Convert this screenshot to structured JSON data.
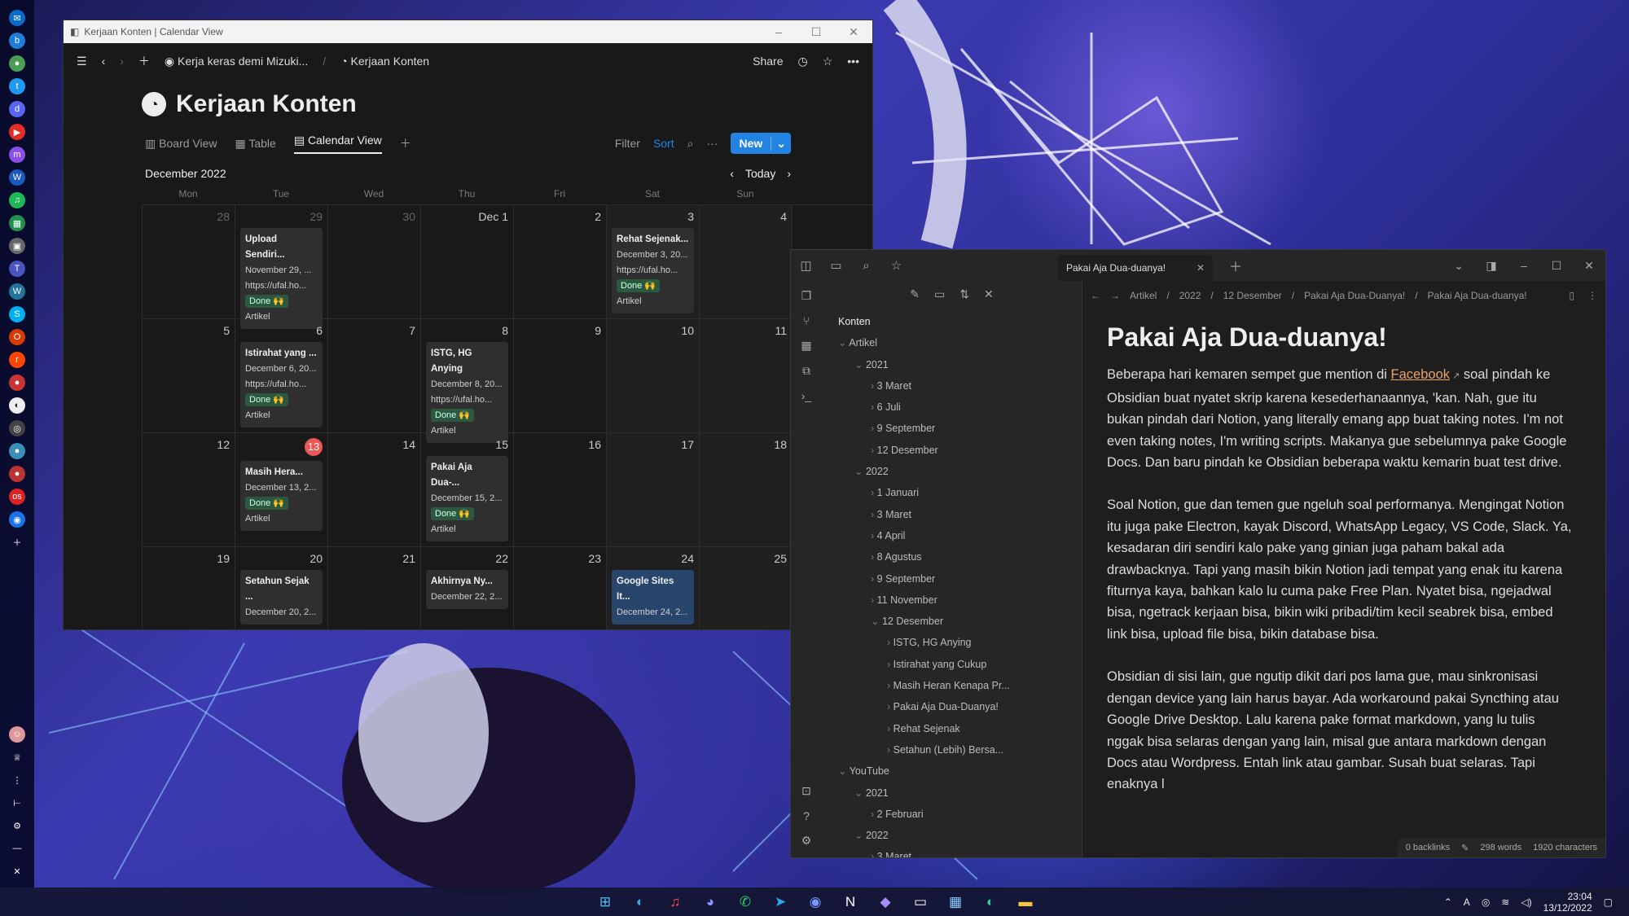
{
  "colors": {
    "notion_bg": "#191919",
    "accent_blue": "#2383e2",
    "done_green": "#2b593f",
    "today_red": "#eb5757",
    "link": "#e8a36a",
    "obsidian_bg": "#1e1e1e"
  },
  "dock": {
    "icons": [
      "outlook-icon",
      "bing-icon",
      "chrome-icon",
      "twitter-icon",
      "discord-icon",
      "youtube-icon",
      "messenger-icon",
      "word-icon",
      "spotify-icon",
      "sheets-icon",
      "app-icon",
      "teams-icon",
      "wordpress-icon",
      "skype-icon",
      "office-icon",
      "reddit-icon",
      "app-icon",
      "app-icon",
      "globe-icon",
      "app-icon",
      "app-icon",
      "app-icon",
      "chat-icon",
      "add-icon"
    ]
  },
  "notion": {
    "window_title": "Kerjaan Konten | Calendar View",
    "breadcrumb_parent": "Kerja keras demi Mizuki...",
    "breadcrumb_current": "Kerjaan Konten",
    "share": "Share",
    "page_title": "Kerjaan Konten",
    "tabs": [
      "Board View",
      "Table",
      "Calendar View"
    ],
    "filter": "Filter",
    "sort": "Sort",
    "new": "New",
    "month": "December 2022",
    "today": "Today",
    "days": [
      "Mon",
      "Tue",
      "Wed",
      "Thu",
      "Fri",
      "Sat",
      "Sun"
    ],
    "cells": [
      {
        "d": "28",
        "m": true
      },
      {
        "d": "29",
        "m": true,
        "card": {
          "t": "Upload Sendiri...",
          "date": "November 29, ...",
          "url": "https://ufal.ho...",
          "badge": "Done 🙌",
          "tag": "Artikel"
        }
      },
      {
        "d": "30",
        "m": true
      },
      {
        "d": "Dec 1"
      },
      {
        "d": "2"
      },
      {
        "d": "3",
        "we": true,
        "card": {
          "t": "Rehat Sejenak...",
          "date": "December 3, 20...",
          "url": "https://ufal.ho...",
          "badge": "Done 🙌",
          "tag": "Artikel"
        }
      },
      {
        "d": "4",
        "we": true
      },
      {
        "d": "5"
      },
      {
        "d": "6",
        "card": {
          "t": "Istirahat yang ...",
          "date": "December 6, 20...",
          "url": "https://ufal.ho...",
          "badge": "Done 🙌",
          "tag": "Artikel"
        }
      },
      {
        "d": "7"
      },
      {
        "d": "8",
        "card": {
          "t": "ISTG, HG Anying",
          "date": "December 8, 20...",
          "url": "https://ufal.ho...",
          "badge": "Done 🙌",
          "tag": "Artikel"
        }
      },
      {
        "d": "9"
      },
      {
        "d": "10",
        "we": true
      },
      {
        "d": "11",
        "we": true
      },
      {
        "d": "12"
      },
      {
        "d": "13",
        "today": true,
        "card": {
          "t": "Masih Hera...",
          "date": "December 13, 2...",
          "url": "",
          "badge": "Done 🙌",
          "tag": "Artikel"
        }
      },
      {
        "d": "14"
      },
      {
        "d": "15",
        "card": {
          "t": "Pakai Aja Dua-...",
          "date": "December 15, 2...",
          "url": "",
          "badge": "Done 🙌",
          "tag": "Artikel"
        }
      },
      {
        "d": "16"
      },
      {
        "d": "17",
        "we": true
      },
      {
        "d": "18",
        "we": true
      },
      {
        "d": "19"
      },
      {
        "d": "20",
        "card": {
          "t": "Setahun Sejak ...",
          "date": "December 20, 2...",
          "url": "",
          "badge": "",
          "tag": ""
        }
      },
      {
        "d": "21"
      },
      {
        "d": "22",
        "card": {
          "t": "Akhirnya Ny...",
          "date": "December 22, 2...",
          "url": "",
          "badge": "",
          "tag": ""
        }
      },
      {
        "d": "23"
      },
      {
        "d": "24",
        "we": true,
        "card": {
          "t": "Google Sites It...",
          "date": "December 24, 2...",
          "url": "",
          "badge": "",
          "tag": "",
          "blue": true
        }
      },
      {
        "d": "25",
        "we": true
      }
    ]
  },
  "obsidian": {
    "tab": "Pakai Aja Dua-duanya!",
    "breadcrumb": [
      "Artikel",
      "2022",
      "12 Desember",
      "Pakai Aja Dua-Duanya!",
      "Pakai Aja Dua-duanya!"
    ],
    "tree": [
      {
        "t": "Konten",
        "l": 0,
        "c": ""
      },
      {
        "t": "Artikel",
        "l": 0,
        "c": "⌄"
      },
      {
        "t": "2021",
        "l": 1,
        "c": "⌄"
      },
      {
        "t": "3 Maret",
        "l": 2,
        "c": "›"
      },
      {
        "t": "6 Juli",
        "l": 2,
        "c": "›"
      },
      {
        "t": "9 September",
        "l": 2,
        "c": "›"
      },
      {
        "t": "12 Desember",
        "l": 2,
        "c": "›"
      },
      {
        "t": "2022",
        "l": 1,
        "c": "⌄"
      },
      {
        "t": "1 Januari",
        "l": 2,
        "c": "›"
      },
      {
        "t": "3 Maret",
        "l": 2,
        "c": "›"
      },
      {
        "t": "4 April",
        "l": 2,
        "c": "›"
      },
      {
        "t": "8 Agustus",
        "l": 2,
        "c": "›"
      },
      {
        "t": "9 September",
        "l": 2,
        "c": "›"
      },
      {
        "t": "11 November",
        "l": 2,
        "c": "›"
      },
      {
        "t": "12 Desember",
        "l": 2,
        "c": "⌄"
      },
      {
        "t": "ISTG, HG Anying",
        "l": 3,
        "c": "›"
      },
      {
        "t": "Istirahat yang Cukup",
        "l": 3,
        "c": "›"
      },
      {
        "t": "Masih Heran Kenapa Pr...",
        "l": 3,
        "c": "›"
      },
      {
        "t": "Pakai Aja Dua-Duanya!",
        "l": 3,
        "c": "›"
      },
      {
        "t": "Rehat Sejenak",
        "l": 3,
        "c": "›"
      },
      {
        "t": "Setahun (Lebih) Bersa...",
        "l": 3,
        "c": "›"
      },
      {
        "t": "YouTube",
        "l": 0,
        "c": "⌄"
      },
      {
        "t": "2021",
        "l": 1,
        "c": "⌄"
      },
      {
        "t": "2 Februari",
        "l": 2,
        "c": "›"
      },
      {
        "t": "2022",
        "l": 1,
        "c": "⌄"
      },
      {
        "t": "3 Maret",
        "l": 2,
        "c": "›"
      }
    ],
    "doc_title": "Pakai Aja Dua-duanya!",
    "p1_pre": "Beberapa hari kemaren sempet gue mention di ",
    "p1_link": "Facebook",
    "p1_post": " soal pindah ke Obsidian buat nyatet skrip karena kesederhanaannya, 'kan. Nah, gue itu bukan pindah dari Notion, yang literally emang app buat taking notes. I'm not even taking notes, I'm writing scripts. Makanya gue sebelumnya pake Google Docs. Dan baru pindah ke Obsidian beberapa waktu kemarin buat test drive.",
    "p2": "Soal Notion, gue dan temen gue ngeluh soal performanya. Mengingat Notion itu juga pake Electron, kayak Discord, WhatsApp Legacy, VS Code, Slack. Ya, kesadaran diri sendiri kalo pake yang ginian juga paham bakal ada drawbacknya. Tapi yang masih bikin Notion jadi tempat yang enak itu karena fiturnya kaya, bahkan kalo lu cuma pake Free Plan. Nyatet bisa, ngejadwal bisa, ngetrack kerjaan bisa, bikin wiki pribadi/tim kecil seabrek bisa, embed link bisa, upload file bisa, bikin database bisa.",
    "p3": "Obsidian di sisi lain, gue ngutip dikit dari pos lama gue, mau sinkronisasi dengan device yang lain harus bayar. Ada workaround pakai Syncthing atau Google Drive Desktop. Lalu karena pake format markdown, yang lu tulis nggak bisa selaras dengan yang lain, misal gue antara markdown dengan Docs atau Wordpress. Entah link atau gambar. Susah buat selaras. Tapi enaknya l",
    "status": {
      "backlinks": "0 backlinks",
      "words": "298 words",
      "chars": "1920 characters"
    }
  },
  "taskbar": {
    "apps": [
      "windows-start-icon",
      "edge-icon",
      "itunes-icon",
      "discord-icon",
      "whatsapp-icon",
      "telegram-icon",
      "messenger-icon",
      "notion-icon",
      "obsidian-icon",
      "terminal-icon",
      "task-manager-icon",
      "edge-dev-icon",
      "file-explorer-icon"
    ],
    "time": "23:04",
    "date": "13/12/2022"
  }
}
